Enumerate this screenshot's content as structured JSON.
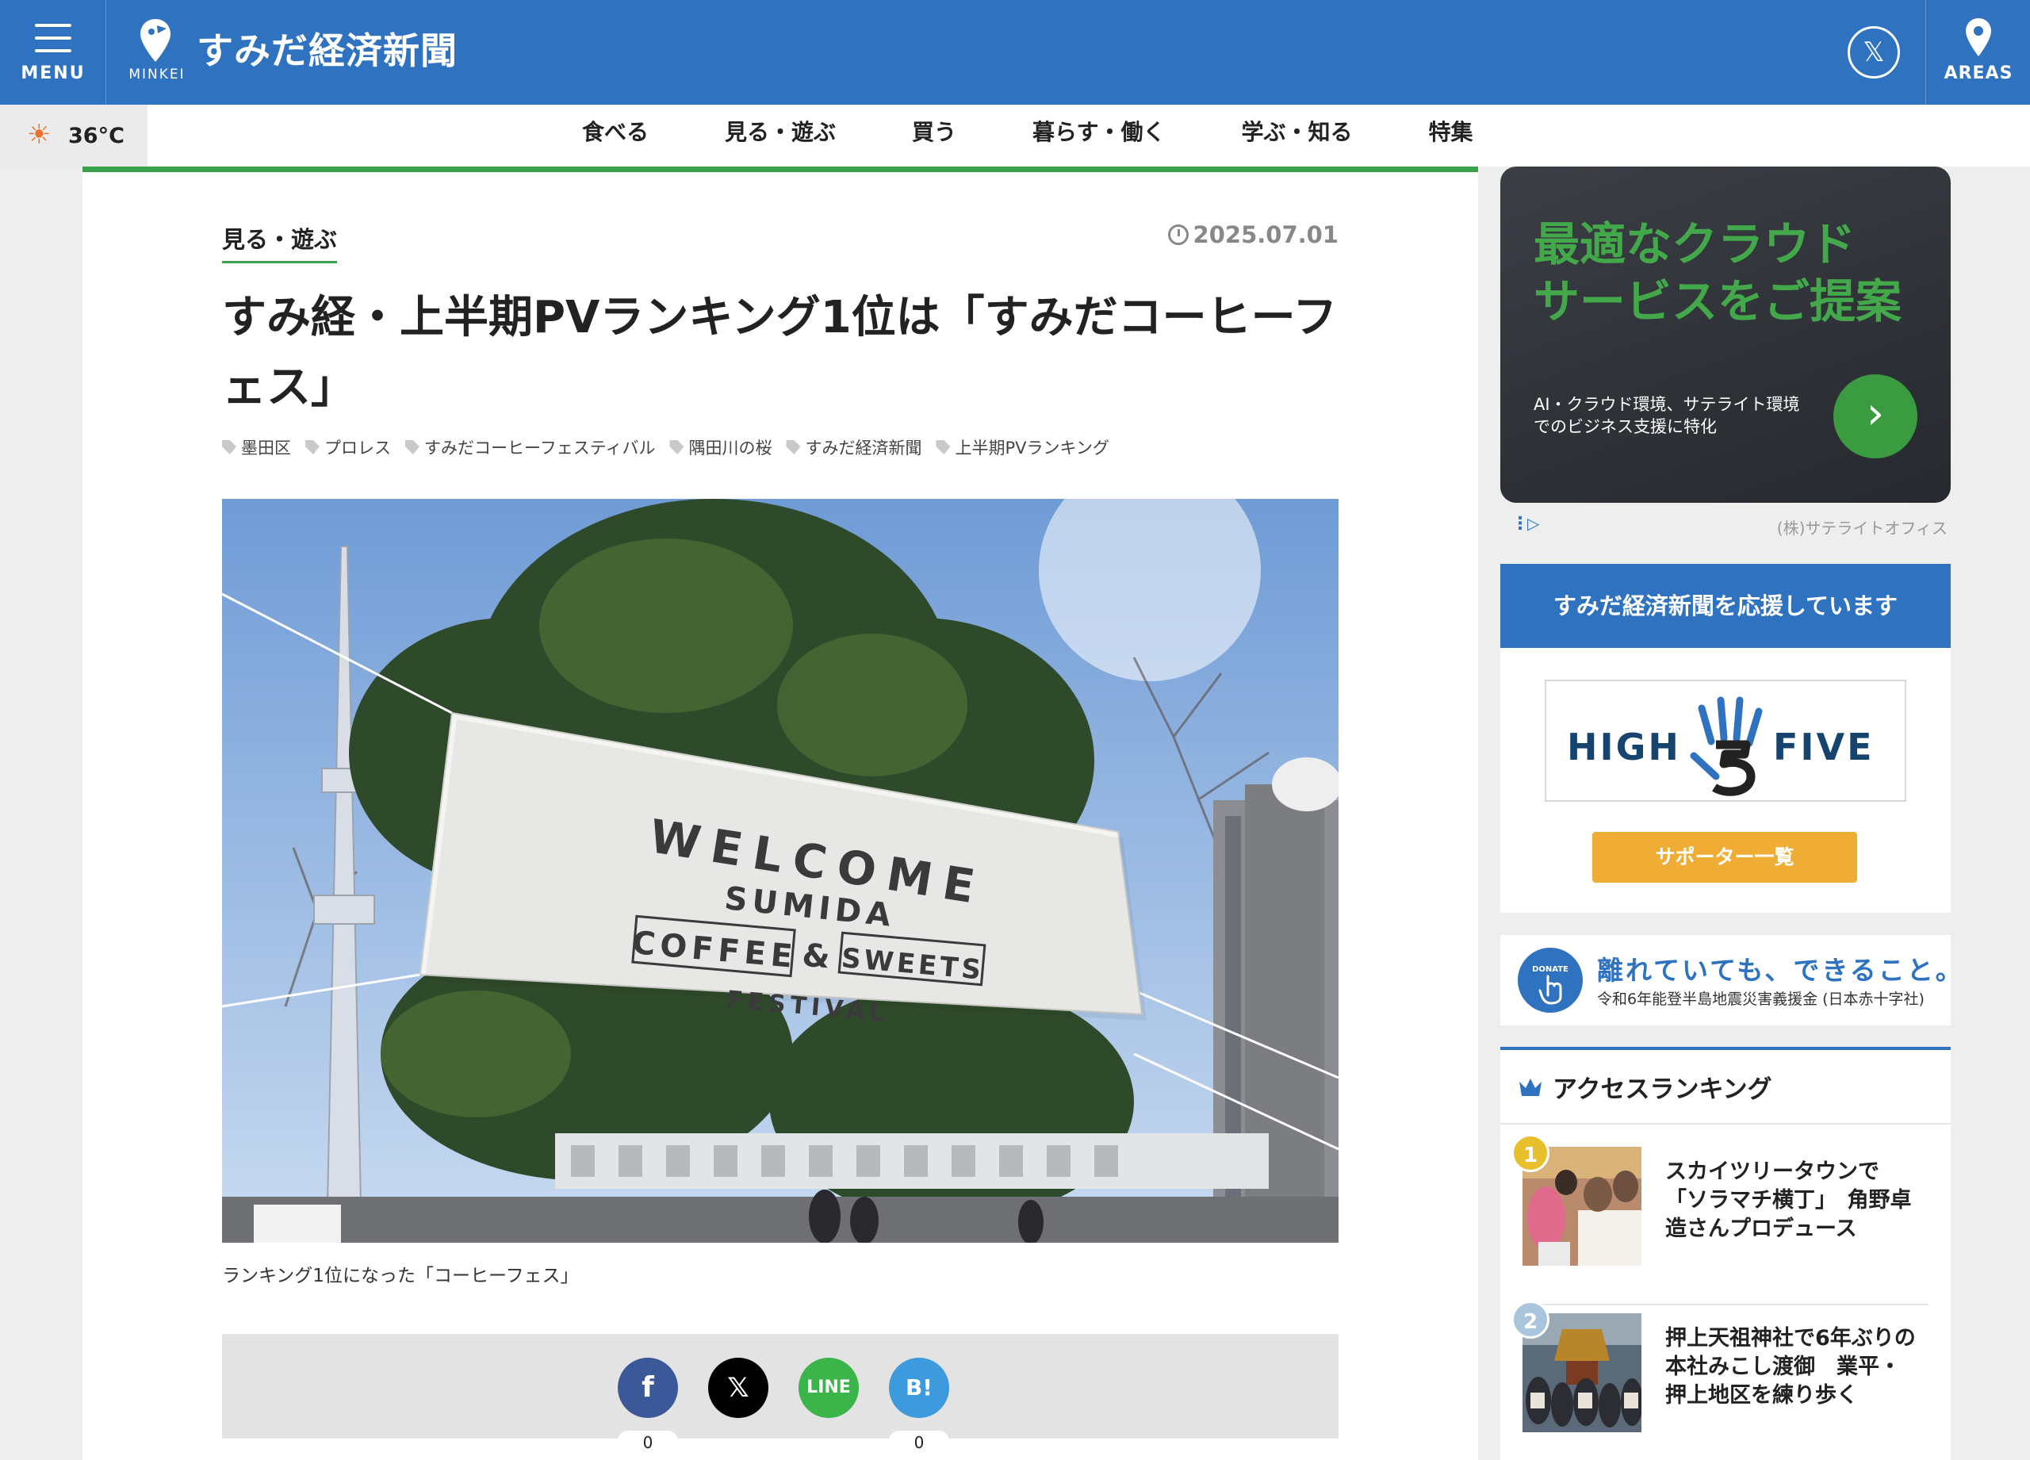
{
  "header": {
    "menu_label": "MENU",
    "brand": "MINKEI",
    "site_name": "すみだ経済新聞",
    "x_label": "𝕏",
    "areas_label": "AREAS",
    "color": "#2f72c0"
  },
  "weather": {
    "temperature": "36°C",
    "icon": "sun-rain-icon"
  },
  "nav": {
    "items": [
      "食べる",
      "見る・遊ぶ",
      "買う",
      "暮らす・働く",
      "学ぶ・知る",
      "特集"
    ]
  },
  "article": {
    "category": "見る・遊ぶ",
    "date": "2025.07.01",
    "title": "すみ経・上半期PVランキング1位は「すみだコーヒーフェス」",
    "tags": [
      "墨田区",
      "プロレス",
      "すみだコーヒーフェスティバル",
      "隅田川の桜",
      "すみだ経済新聞",
      "上半期PVランキング"
    ],
    "photo_banner": {
      "line1": "WELCOME",
      "line2": "SUMIDA",
      "coffee": "COFFEE",
      "amp": "&",
      "sweets": "SWEETS",
      "festival": "FESTIVAL"
    },
    "caption": "ランキング1位になった「コーヒーフェス」",
    "accent_color": "#3aa14b"
  },
  "share": {
    "facebook": {
      "label": "f",
      "count": "0",
      "color": "#3b5998"
    },
    "x": {
      "label": "𝕏",
      "color": "#000000"
    },
    "line": {
      "label": "LINE",
      "color": "#3bb44a"
    },
    "hatena": {
      "label": "B!",
      "count": "0",
      "color": "#3d9adc"
    }
  },
  "ad": {
    "headline_line1": "最適なクラウド",
    "headline_line2": "サービスをご提案",
    "sub_line1": "AI・クラウド環境、サテライト環境",
    "sub_line2": "でのビジネス支援に特化",
    "arrow": "›",
    "advertiser": "(株)サテライトオフィス"
  },
  "support": {
    "heading": "すみだ経済新聞を応援しています",
    "logo_left": "HIGH",
    "logo_right": "FIVE",
    "button": "サポーター一覧"
  },
  "donate": {
    "icon_label": "DONATE",
    "heading": "離れていても、できること。",
    "sub": "令和6年能登半島地震災害義援金 (日本赤十字社)"
  },
  "ranking": {
    "title": "アクセスランキング",
    "items": [
      {
        "rank": "1",
        "text": "スカイツリータウンで「ソラマチ横丁」　角野卓造さんプロデュース",
        "badge_color": "#e8c02c"
      },
      {
        "rank": "2",
        "text": "押上天祖神社で6年ぶりの本社みこし渡御　業平・押上地区を練り歩く",
        "badge_color": "#a9c4dd"
      }
    ]
  }
}
